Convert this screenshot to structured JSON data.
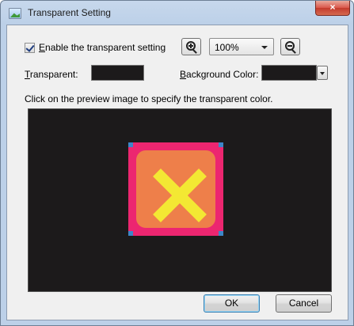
{
  "window": {
    "title": "Transparent Setting",
    "close_glyph": "×"
  },
  "options": {
    "enable_label": "Enable the transparent setting",
    "enable_checked": true,
    "zoom_value": "100%",
    "transparent_label": "Transparent:",
    "background_label": "Background Color:",
    "hint": "Click on the preview image to specify the transparent color."
  },
  "buttons": {
    "ok": "OK",
    "cancel": "Cancel"
  },
  "icons": {
    "app": "image-icon",
    "zoom_in": "zoom-in-icon",
    "zoom_out": "zoom-out-icon",
    "dropdown": "chevron-down-icon"
  },
  "colors": {
    "transparent_swatch": "#1c1a1b",
    "background_swatch": "#1c1a1b",
    "preview_bg": "#1c1a1b",
    "image_border": "#ec2670",
    "image_fill": "#ee7f4a",
    "image_x": "#f3e833"
  }
}
